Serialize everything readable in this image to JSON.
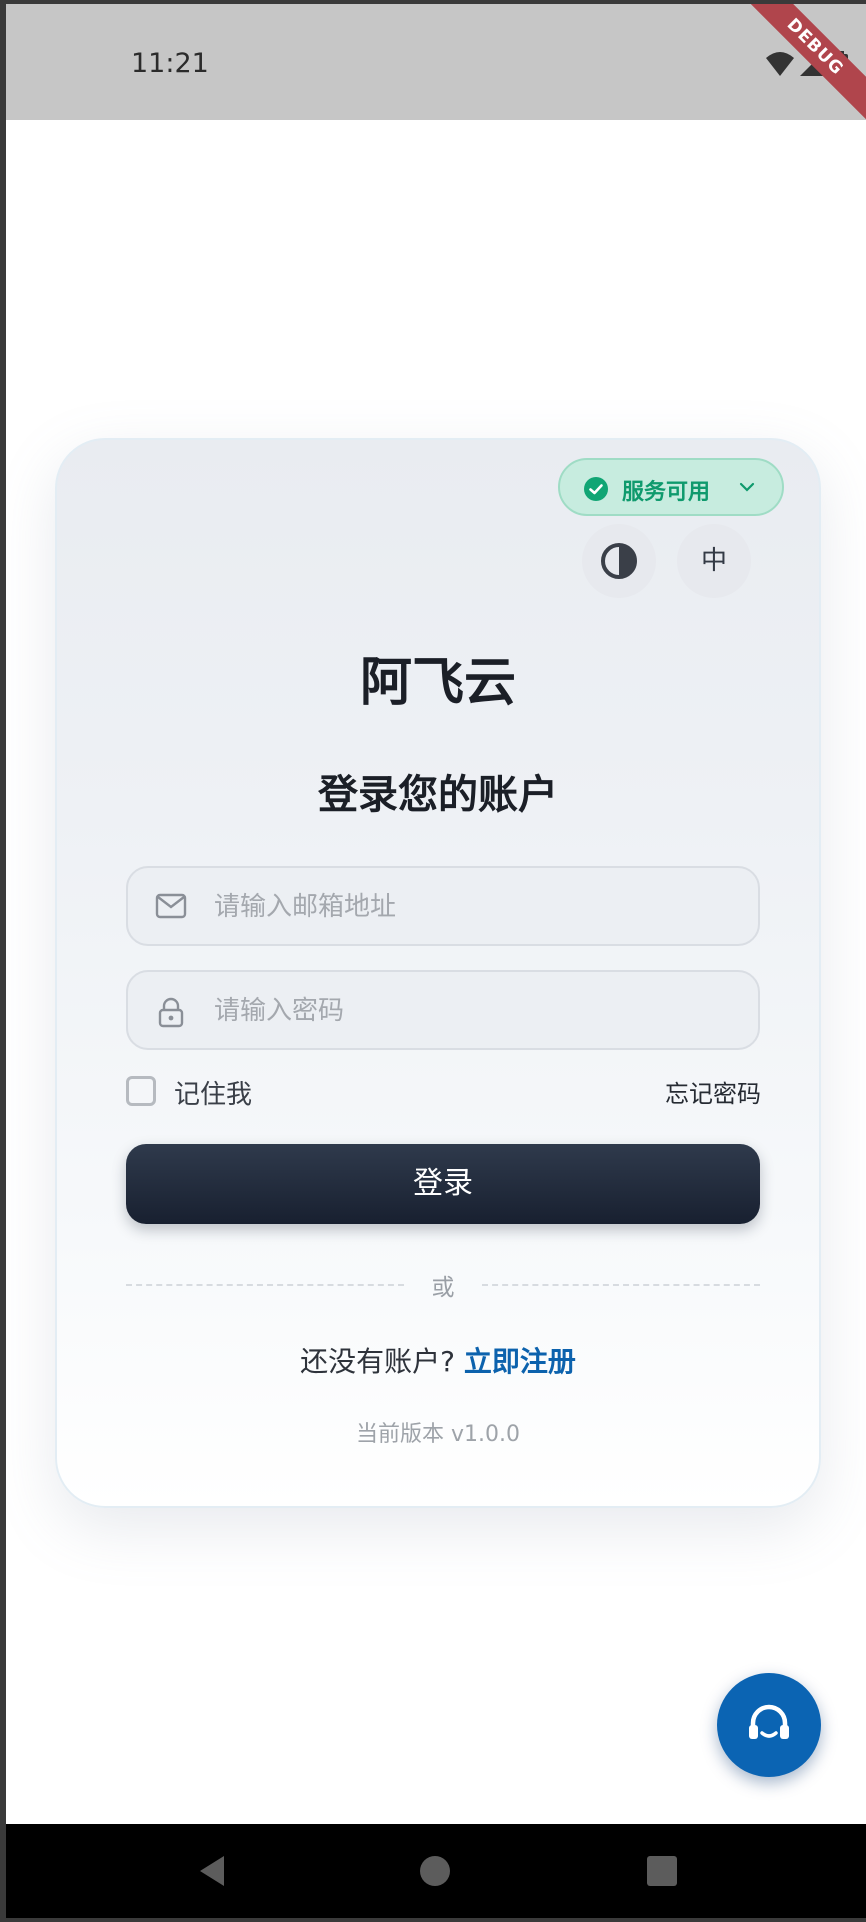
{
  "status_bar": {
    "time": "11:21",
    "debug_label": "DEBUG",
    "icons": [
      "wifi-icon",
      "signal-icon",
      "battery-icon"
    ]
  },
  "card": {
    "service_status": {
      "label": "服务可用",
      "icon": "check-circle-icon",
      "color": "#11a574"
    },
    "theme_toggle_icon": "contrast-icon",
    "language_button": "中",
    "app_title": "阿飞云",
    "subtitle": "登录您的账户",
    "email": {
      "placeholder": "请输入邮箱地址",
      "value": "",
      "icon": "mail-icon"
    },
    "password": {
      "placeholder": "请输入密码",
      "value": "",
      "icon": "lock-icon"
    },
    "remember_me": {
      "label": "记住我",
      "checked": false
    },
    "forgot_password": "忘记密码",
    "login_button": "登录",
    "divider_text": "或",
    "register_prompt": "还没有账户?",
    "register_link": "立即注册",
    "version": "当前版本 v1.0.0"
  },
  "support_fab": {
    "icon": "headset-support-icon",
    "color": "#0b64b3"
  },
  "nav_bar": {
    "buttons": [
      "back-icon",
      "home-icon",
      "recents-icon"
    ]
  }
}
